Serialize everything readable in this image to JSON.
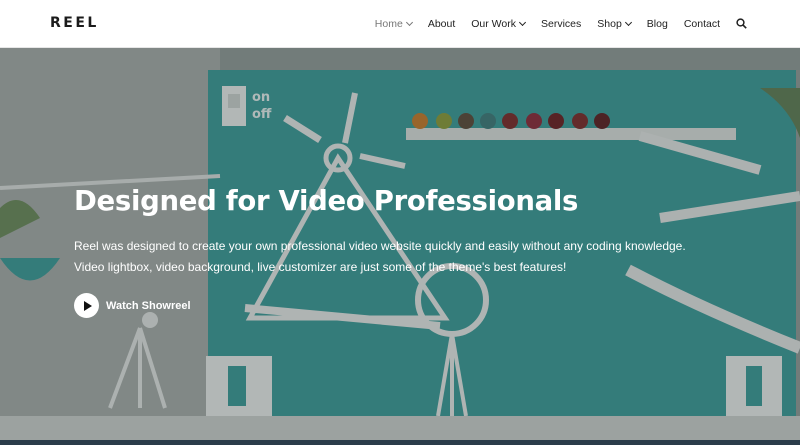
{
  "header": {
    "logo": "REEL",
    "nav": [
      {
        "label": "Home",
        "dropdown": true,
        "active": true
      },
      {
        "label": "About",
        "dropdown": false
      },
      {
        "label": "Our Work",
        "dropdown": true
      },
      {
        "label": "Services",
        "dropdown": false
      },
      {
        "label": "Shop",
        "dropdown": true
      },
      {
        "label": "Blog",
        "dropdown": false
      },
      {
        "label": "Contact",
        "dropdown": false
      }
    ],
    "search_icon": "search-icon"
  },
  "hero": {
    "switch_on": "on",
    "switch_off": "off",
    "title": "Designed for Video Professionals",
    "description_line1": "Reel was designed to create your own professional video website quickly and easily without any coding knowledge.",
    "description_line2": "Video lightbox, video background, live customizer are just some of the theme's best features!",
    "cta_label": "Watch Showreel",
    "cta_icon": "play-icon"
  },
  "colors": {
    "accent_teal": "#3a9a98",
    "text_dark": "#1b1b1b",
    "nav_active": "#777777"
  }
}
